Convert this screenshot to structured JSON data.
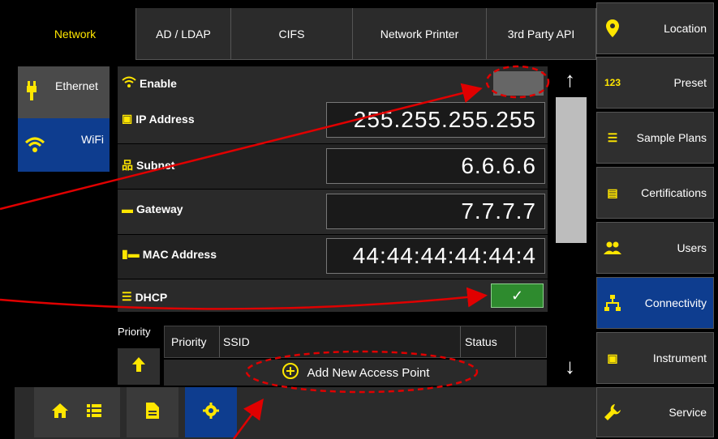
{
  "tabs": [
    {
      "label": "Network"
    },
    {
      "label": "AD / LDAP"
    },
    {
      "label": "CIFS"
    },
    {
      "label": "Network Printer"
    },
    {
      "label": "3rd Party API"
    }
  ],
  "sidebar": {
    "items": [
      {
        "label": "Ethernet",
        "icon": "ethernet-icon"
      },
      {
        "label": "WiFi",
        "icon": "wifi-icon",
        "active": true
      }
    ]
  },
  "settings": {
    "enable_label": "Enable",
    "ip_label": "IP Address",
    "ip_value": "255.255.255.255",
    "subnet_label": "Subnet",
    "subnet_value": "6.6.6.6",
    "gateway_label": "Gateway",
    "gateway_value": "7.7.7.7",
    "mac_label": "MAC Address",
    "mac_value": "44:44:44:44:44:4",
    "dhcp_label": "DHCP",
    "dhcp_checked": true,
    "enable_checked": false
  },
  "access_points": {
    "priority_side_label": "Priority",
    "columns": [
      "Priority",
      "SSID",
      "Status"
    ],
    "add_label": "Add New Access Point"
  },
  "right_nav": [
    {
      "label": "Location",
      "icon": "location-pin-icon"
    },
    {
      "label": "Preset",
      "icon": "123-icon",
      "icon_text": "123"
    },
    {
      "label": "Sample Plans",
      "icon": "list-arrow-icon"
    },
    {
      "label": "Certifications",
      "icon": "certificate-icon"
    },
    {
      "label": "Users",
      "icon": "users-icon"
    },
    {
      "label": "Connectivity",
      "icon": "network-icon",
      "active": true
    },
    {
      "label": "Instrument",
      "icon": "instrument-icon"
    },
    {
      "label": "Service",
      "icon": "wrench-icon"
    }
  ],
  "bottom_bar": [
    {
      "icon": "home-icon"
    },
    {
      "icon": "list-icon"
    },
    {
      "icon": "document-icon"
    },
    {
      "icon": "gear-icon",
      "active": true
    }
  ],
  "colors": {
    "accent": "#ffe600",
    "active_blue": "#0e3d8f",
    "annotation_red": "#e00000",
    "check_green": "#2e8b2e"
  }
}
